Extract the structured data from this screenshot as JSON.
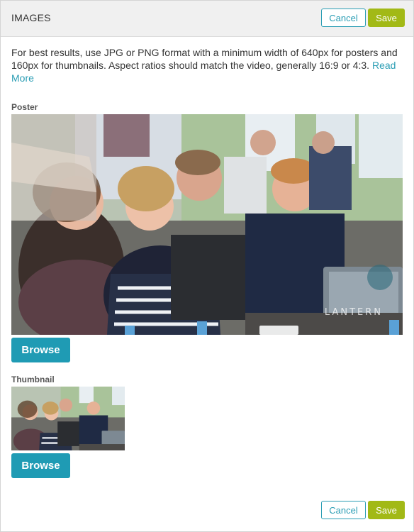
{
  "header": {
    "title": "IMAGES",
    "cancel_label": "Cancel",
    "save_label": "Save"
  },
  "intro": {
    "text": "For best results, use JPG or PNG format with a minimum width of 640px for posters and 160px for thumbnails. Aspect ratios should match the video, generally 16:9 or 4:3.",
    "link_label": "Read More"
  },
  "poster": {
    "label": "Poster",
    "browse_label": "Browse",
    "watermark": "LANTERN"
  },
  "thumbnail": {
    "label": "Thumbnail",
    "browse_label": "Browse"
  },
  "footer": {
    "cancel_label": "Cancel",
    "save_label": "Save"
  },
  "colors": {
    "accent": "#2a9db4",
    "browse": "#1f9bb4",
    "save": "#a2b916",
    "header_bg": "#f0f0f0"
  }
}
